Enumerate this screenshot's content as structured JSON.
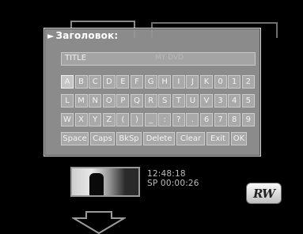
{
  "dialog": {
    "title": "Заголовок:",
    "title_value": "TITLE",
    "title_ghost": "MY DVD"
  },
  "keyboard": {
    "rows": [
      [
        "A",
        "B",
        "C",
        "D",
        "E",
        "F",
        "G",
        "H",
        "I",
        "J",
        "K",
        "0",
        "1",
        "2"
      ],
      [
        "L",
        "M",
        "N",
        "O",
        "P",
        "Q",
        "R",
        "S",
        "T",
        "U",
        "V",
        "3",
        "4",
        "5"
      ],
      [
        "W",
        "X",
        "Y",
        "Z",
        "(",
        ")",
        "_",
        ":",
        "?",
        ".",
        "6",
        "7",
        "8",
        "9"
      ]
    ],
    "functions": [
      "Space",
      "Caps",
      "BkSp",
      "Delete",
      "Clear",
      "Exit",
      "OK"
    ],
    "selected": "A"
  },
  "background": {
    "time": "12:48:18",
    "position": "SP 00:00:26",
    "logo": "RW"
  }
}
